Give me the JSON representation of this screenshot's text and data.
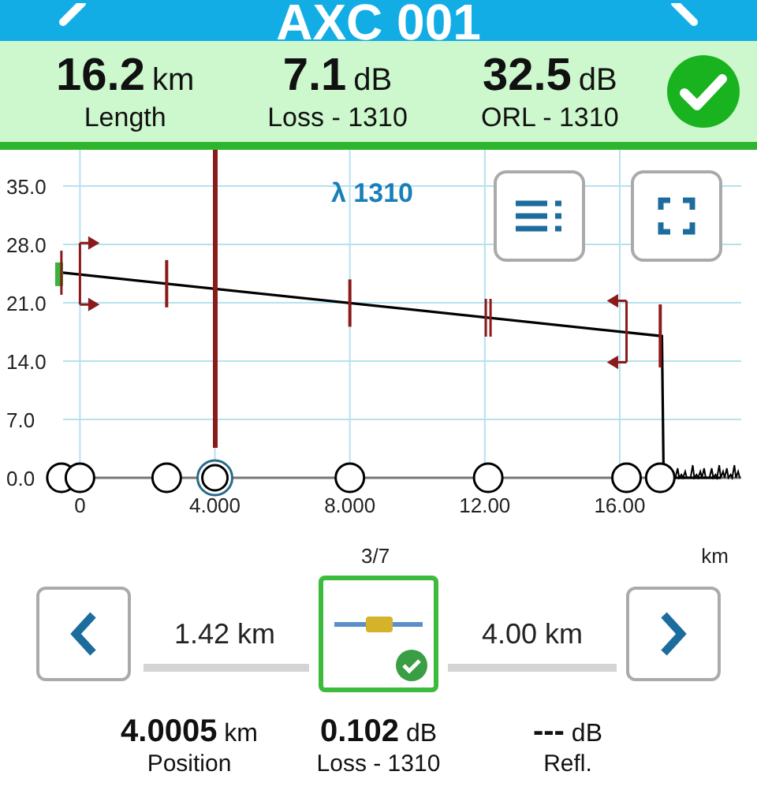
{
  "header": {
    "title": "AXC 001"
  },
  "summary": [
    {
      "value": "16.2",
      "unit": "km",
      "label": "Length"
    },
    {
      "value": "7.1",
      "unit": "dB",
      "label": "Loss - 1310"
    },
    {
      "value": "32.5",
      "unit": "dB",
      "label": "ORL - 1310"
    }
  ],
  "summary_passed": true,
  "chart": {
    "wavelength": "λ 1310",
    "chart_data": {
      "type": "line",
      "xlim": [
        -0.5,
        19.6
      ],
      "ylim": [
        0,
        35
      ],
      "grid": true,
      "xticks": [
        {
          "value": 0,
          "label": "0"
        },
        {
          "value": 4,
          "label": "4.000"
        },
        {
          "value": 8,
          "label": "8.000"
        },
        {
          "value": 12,
          "label": "12.00"
        },
        {
          "value": 16,
          "label": "16.00"
        }
      ],
      "yticks": [
        {
          "value": 0,
          "label": "0.0"
        },
        {
          "value": 7,
          "label": "7.0"
        },
        {
          "value": 14,
          "label": "14.0"
        },
        {
          "value": 21,
          "label": "21.0"
        },
        {
          "value": 28,
          "label": "28.0"
        },
        {
          "value": 35,
          "label": "35.0"
        }
      ],
      "series": [
        {
          "color": "#000000",
          "x": [
            -0.5,
            17.25,
            17.3,
            19.0
          ],
          "values": [
            24.6,
            17.0,
            0,
            0
          ]
        }
      ]
    },
    "events": [
      {
        "kind": "start",
        "selected": false
      },
      {
        "kind": "span-start",
        "selected": false
      },
      {
        "kind": "event",
        "selected": false
      },
      {
        "kind": "event",
        "selected": true
      },
      {
        "kind": "event",
        "selected": false
      },
      {
        "kind": "double",
        "selected": false
      },
      {
        "kind": "span-end",
        "selected": false
      },
      {
        "kind": "end",
        "selected": false
      }
    ]
  },
  "event_nav": {
    "index": "3/7",
    "unit": "km",
    "prev_distance": "1.42 km",
    "next_distance": "4.00 km",
    "event": {
      "kind": "connector",
      "passed": true
    },
    "stats": [
      {
        "value": "4.0005",
        "unit": "km",
        "label": "Position"
      },
      {
        "value": "0.102",
        "unit": "dB",
        "label": "Loss - 1310"
      },
      {
        "value": "---",
        "unit": "dB",
        "label": "Refl."
      }
    ]
  }
}
